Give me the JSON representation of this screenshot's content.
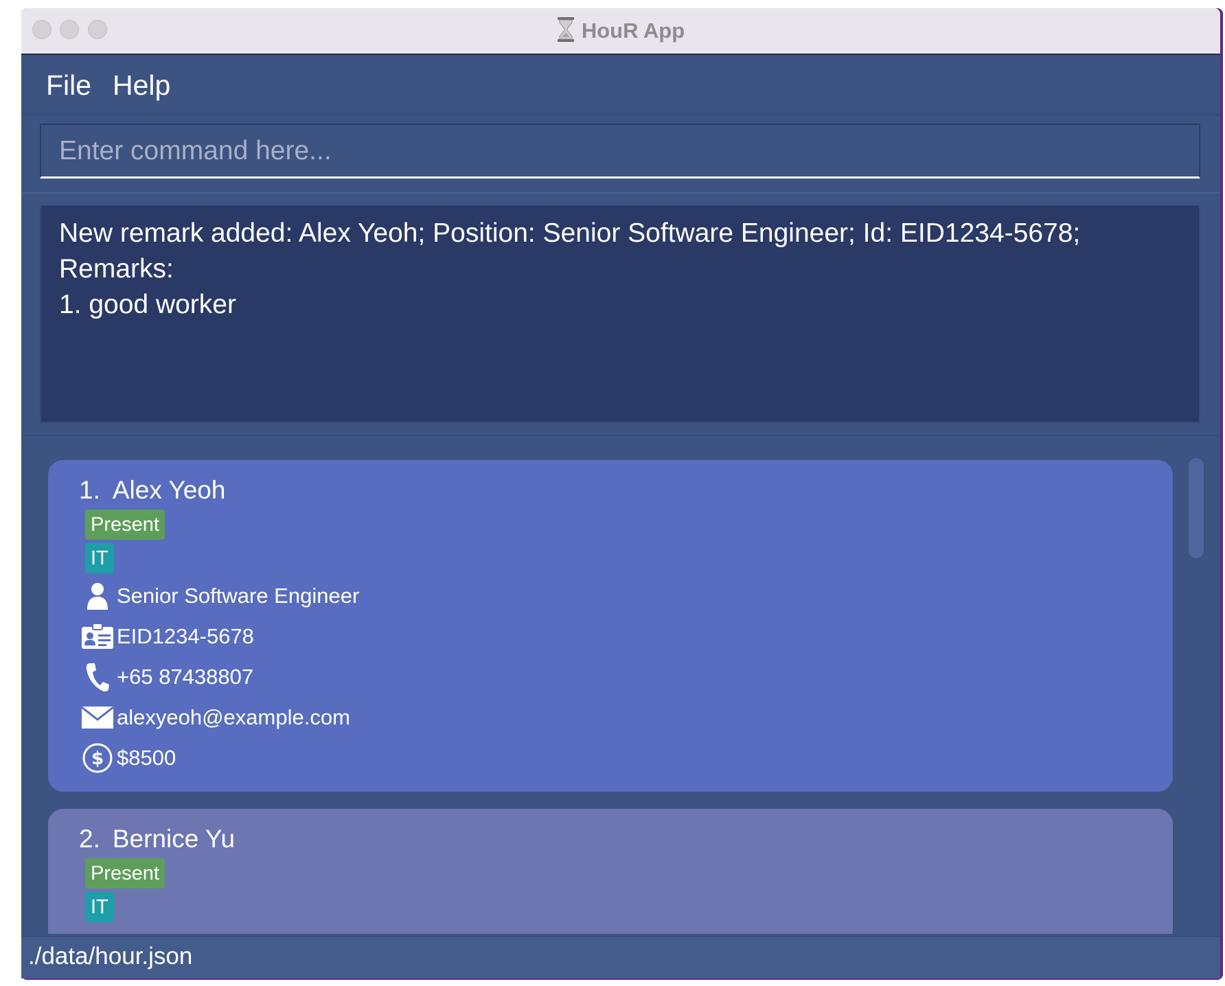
{
  "window": {
    "title": "HouR App"
  },
  "menu": {
    "file": "File",
    "help": "Help"
  },
  "command": {
    "placeholder": "Enter command here...",
    "value": ""
  },
  "result": {
    "text": "New remark added: Alex Yeoh; Position: Senior Software Engineer; Id: EID1234-5678;\nRemarks:\n1. good worker"
  },
  "employees": [
    {
      "index": "1.",
      "name": "Alex Yeoh",
      "status": "Present",
      "department": "IT",
      "position": "Senior Software Engineer",
      "id": "EID1234-5678",
      "phone": "+65 87438807",
      "email": "alexyeoh@example.com",
      "salary": "$8500"
    },
    {
      "index": "2.",
      "name": "Bernice Yu",
      "status": "Present",
      "department": "IT"
    }
  ],
  "icons": {
    "app": "hourglass-icon",
    "position": "person-icon",
    "id": "id-card-icon",
    "phone": "phone-icon",
    "email": "envelope-icon",
    "salary": "dollar-coin-icon"
  },
  "colors": {
    "background": "#3d5382",
    "result_box": "#2a3966",
    "selected_card": "#586dbf",
    "card": "#6d76b1",
    "status_tag": "#5e9e5b",
    "department_tag": "#1e9ea8"
  },
  "status_bar": {
    "path": "./data/hour.json"
  }
}
